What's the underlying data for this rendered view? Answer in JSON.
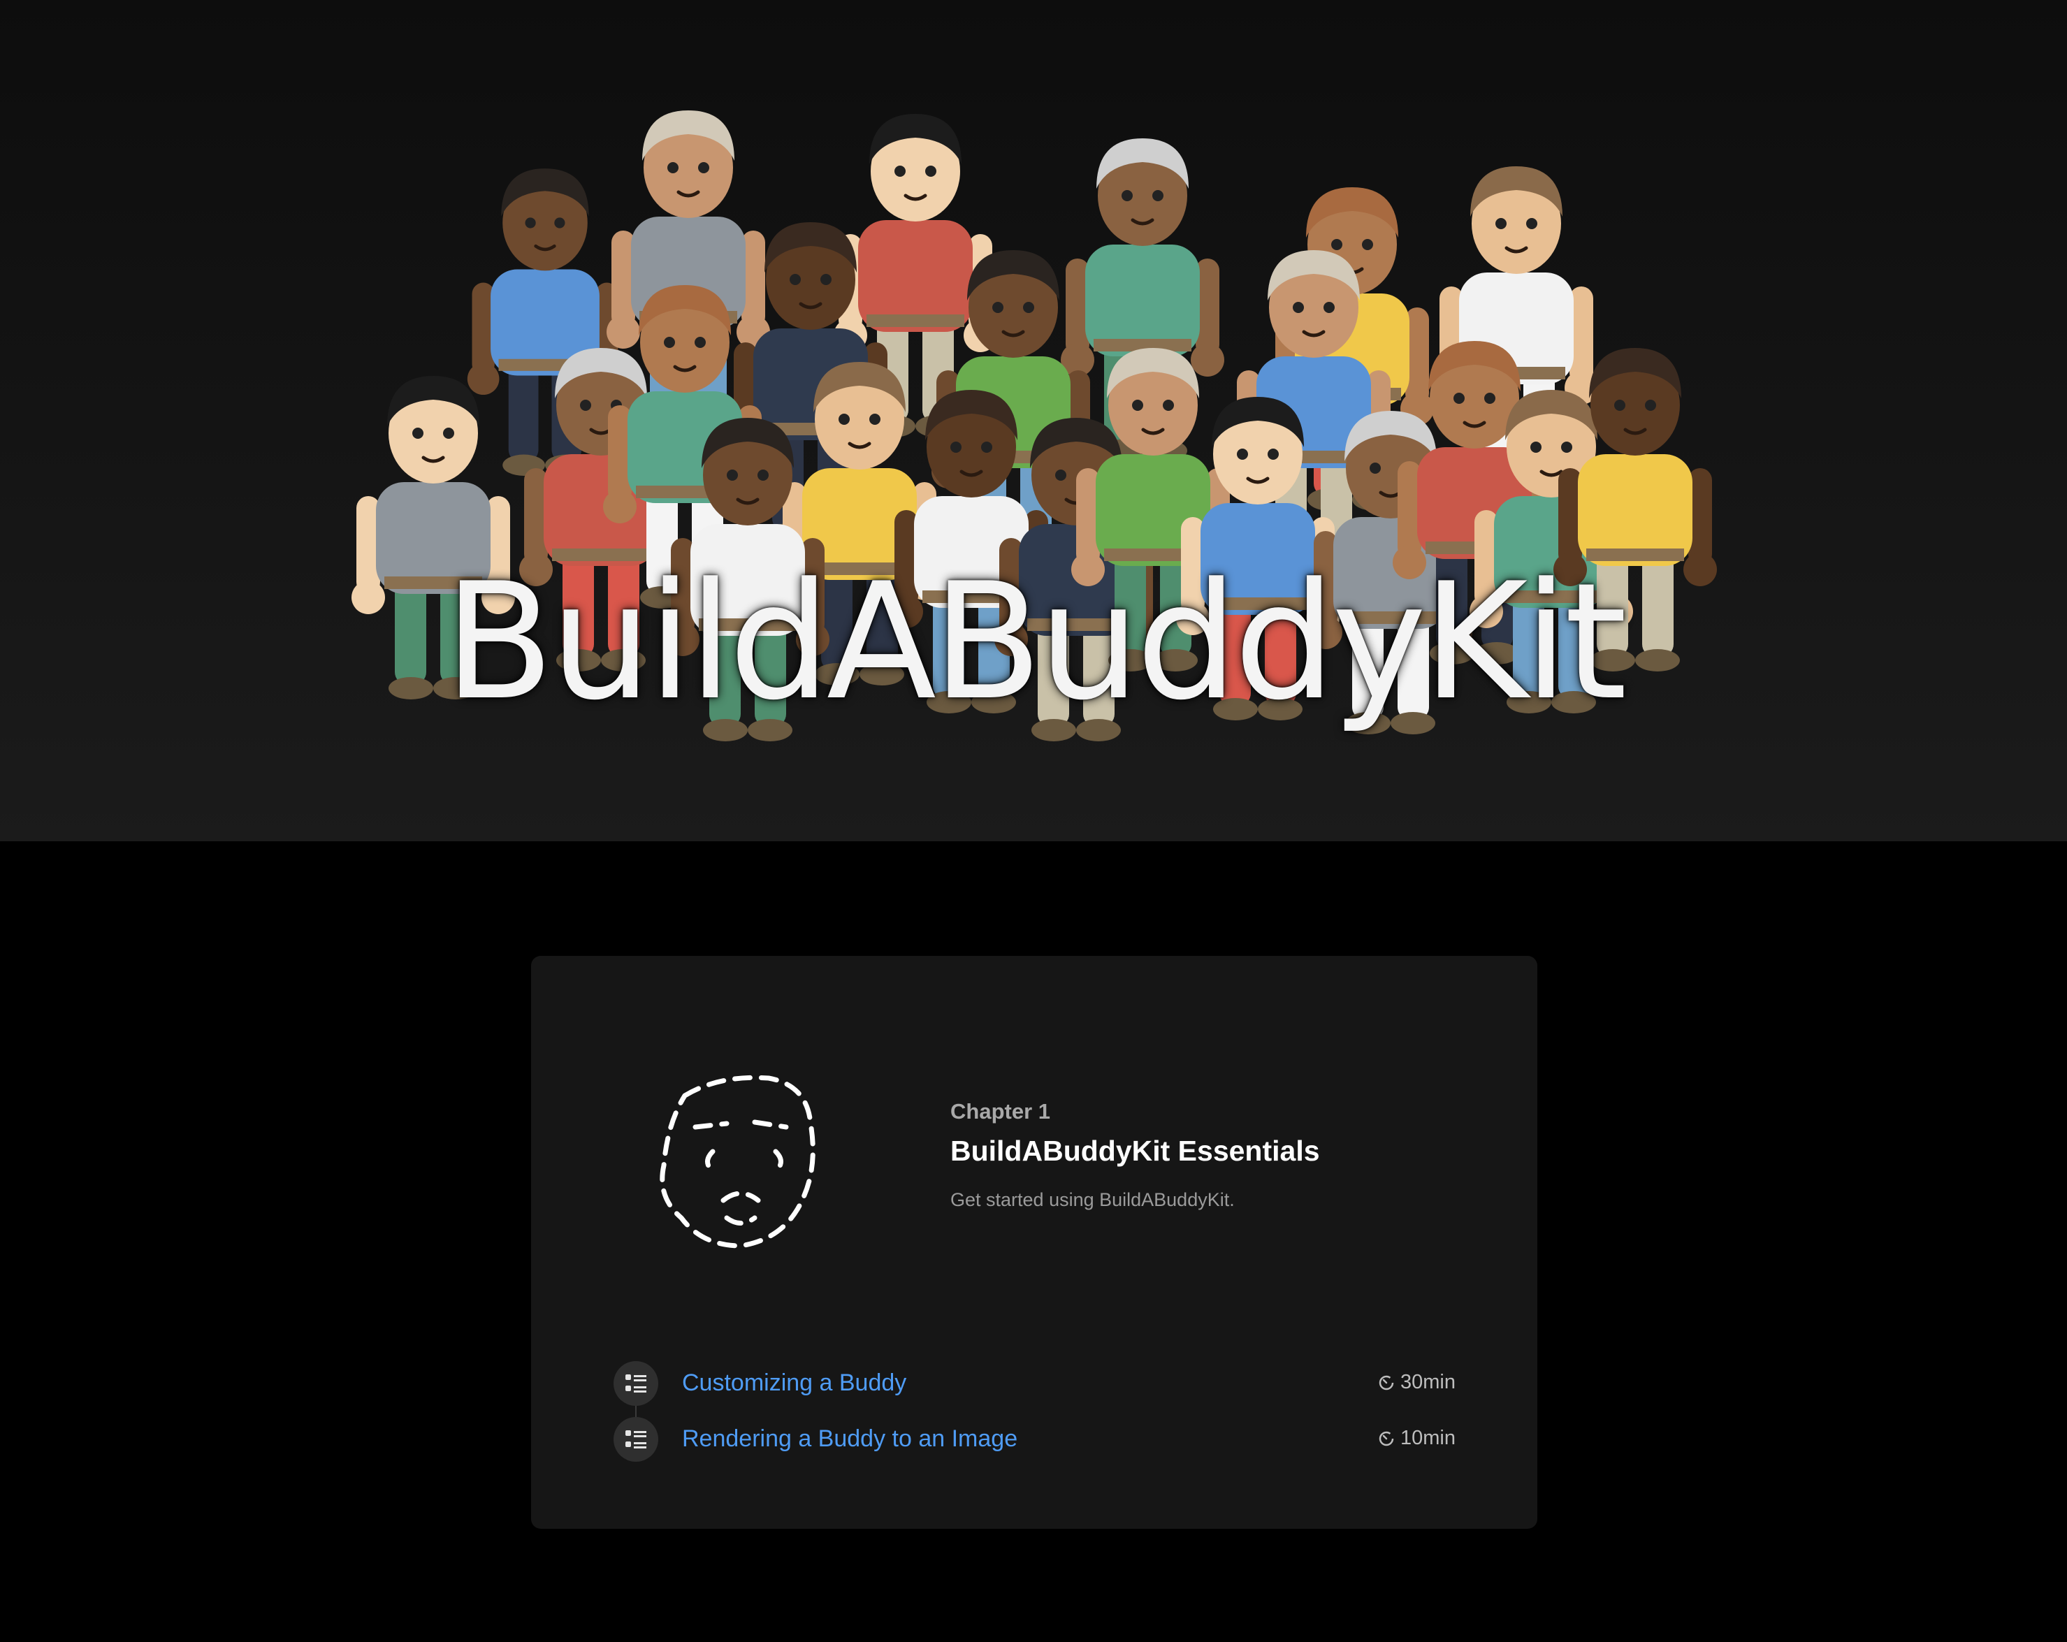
{
  "hero": {
    "title": "BuildABuddyKit",
    "illustration_icon": "buddy-crowd-illustration"
  },
  "chapter": {
    "kicker": "Chapter 1",
    "title": "BuildABuddyKit Essentials",
    "description": "Get started using BuildABuddyKit.",
    "icon": "dashed-face-icon"
  },
  "tutorials": [
    {
      "label": "Customizing a Buddy",
      "duration": "30min",
      "icon": "tutorial-list-icon"
    },
    {
      "label": "Rendering a Buddy to an Image",
      "duration": "10min",
      "icon": "tutorial-list-icon"
    }
  ],
  "colors": {
    "background": "#000000",
    "card": "#161616",
    "link": "#4f9cf5",
    "hero_top": "#0d0d0d",
    "hero_bottom": "#1b1b1b"
  }
}
